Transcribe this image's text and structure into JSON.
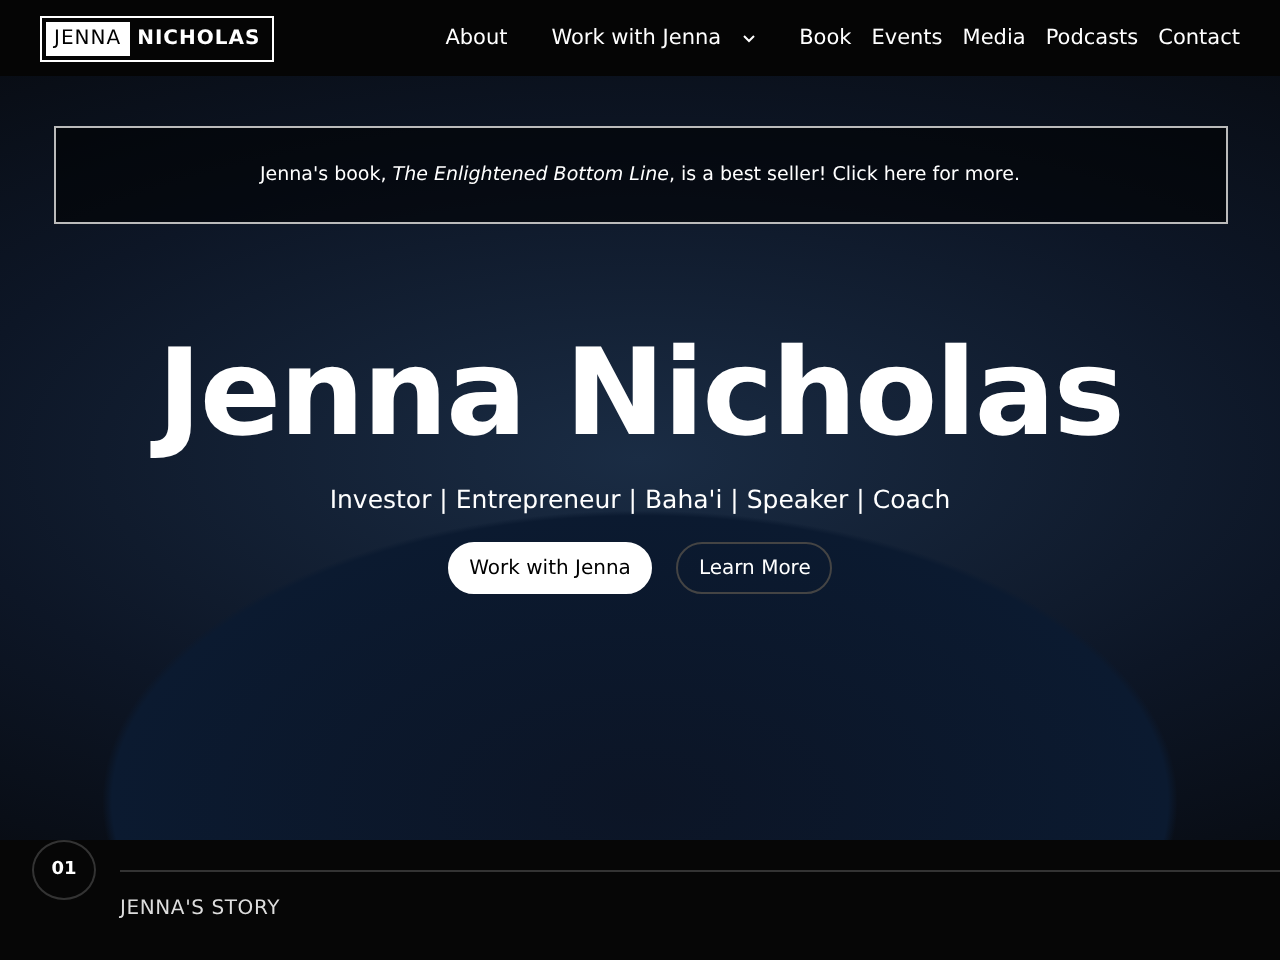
{
  "logo": {
    "first": "JENNA",
    "second": "NICHOLAS"
  },
  "nav": [
    {
      "label": "About",
      "kind": "link"
    },
    {
      "label": "Work with Jenna",
      "kind": "dropdown"
    },
    {
      "label": "Book",
      "kind": "link"
    },
    {
      "label": "Events",
      "kind": "link"
    },
    {
      "label": "Media",
      "kind": "link"
    },
    {
      "label": "Podcasts",
      "kind": "link"
    },
    {
      "label": "Contact",
      "kind": "link"
    }
  ],
  "banner": "Jenna's book, *The Enlightened Bottom Line*, is a best seller! Click here for more.",
  "hero": {
    "title": "Jenna Nicholas",
    "tagline": "Investor | Entrepreneur | Baha'i | Speaker | Coach",
    "buttons": [
      {
        "label": "Work with Jenna",
        "kind": "primary"
      },
      {
        "label": "Learn More",
        "kind": "outline"
      }
    ]
  },
  "section": {
    "number": "01",
    "title": "JENNA'S STORY"
  }
}
